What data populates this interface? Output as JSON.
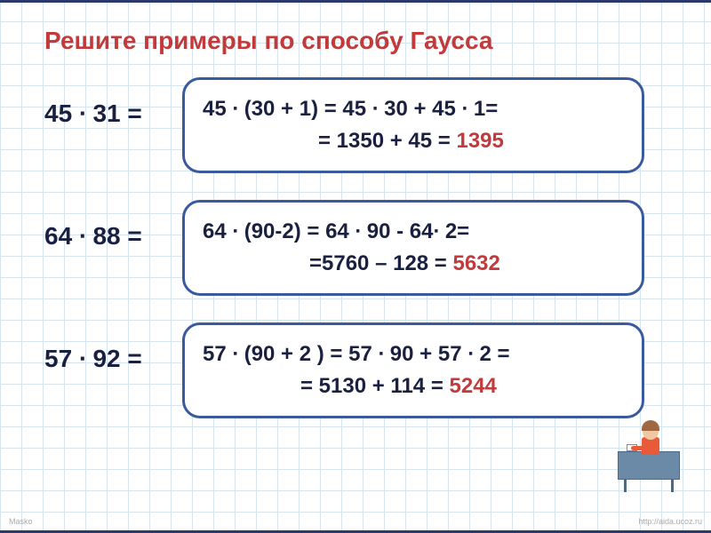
{
  "title": "Решите примеры по способу Гаусса",
  "rows": [
    {
      "problem": "45 ∙ 31 =",
      "line1": "45 ∙ (30 + 1) = 45 ∙ 30 + 45 ∙ 1=",
      "line2_prefix": "= 1350 +  45 = ",
      "result": "1395"
    },
    {
      "problem": "64 ∙ 88 =",
      "line1": "64 ∙ (90-2) = 64 ∙ 90 - 64∙ 2=",
      "line2_prefix": "=5760 – 128 = ",
      "result": "5632"
    },
    {
      "problem": "57 ∙ 92 =",
      "line1": "57 ∙ (90  + 2 ) = 57 ∙ 90 + 57 ∙ 2 =",
      "line2_prefix": "= 5130 +  114 = ",
      "result": "5244"
    }
  ],
  "watermark_left": "Masko",
  "watermark_right": "http://aida.ucoz.ru"
}
